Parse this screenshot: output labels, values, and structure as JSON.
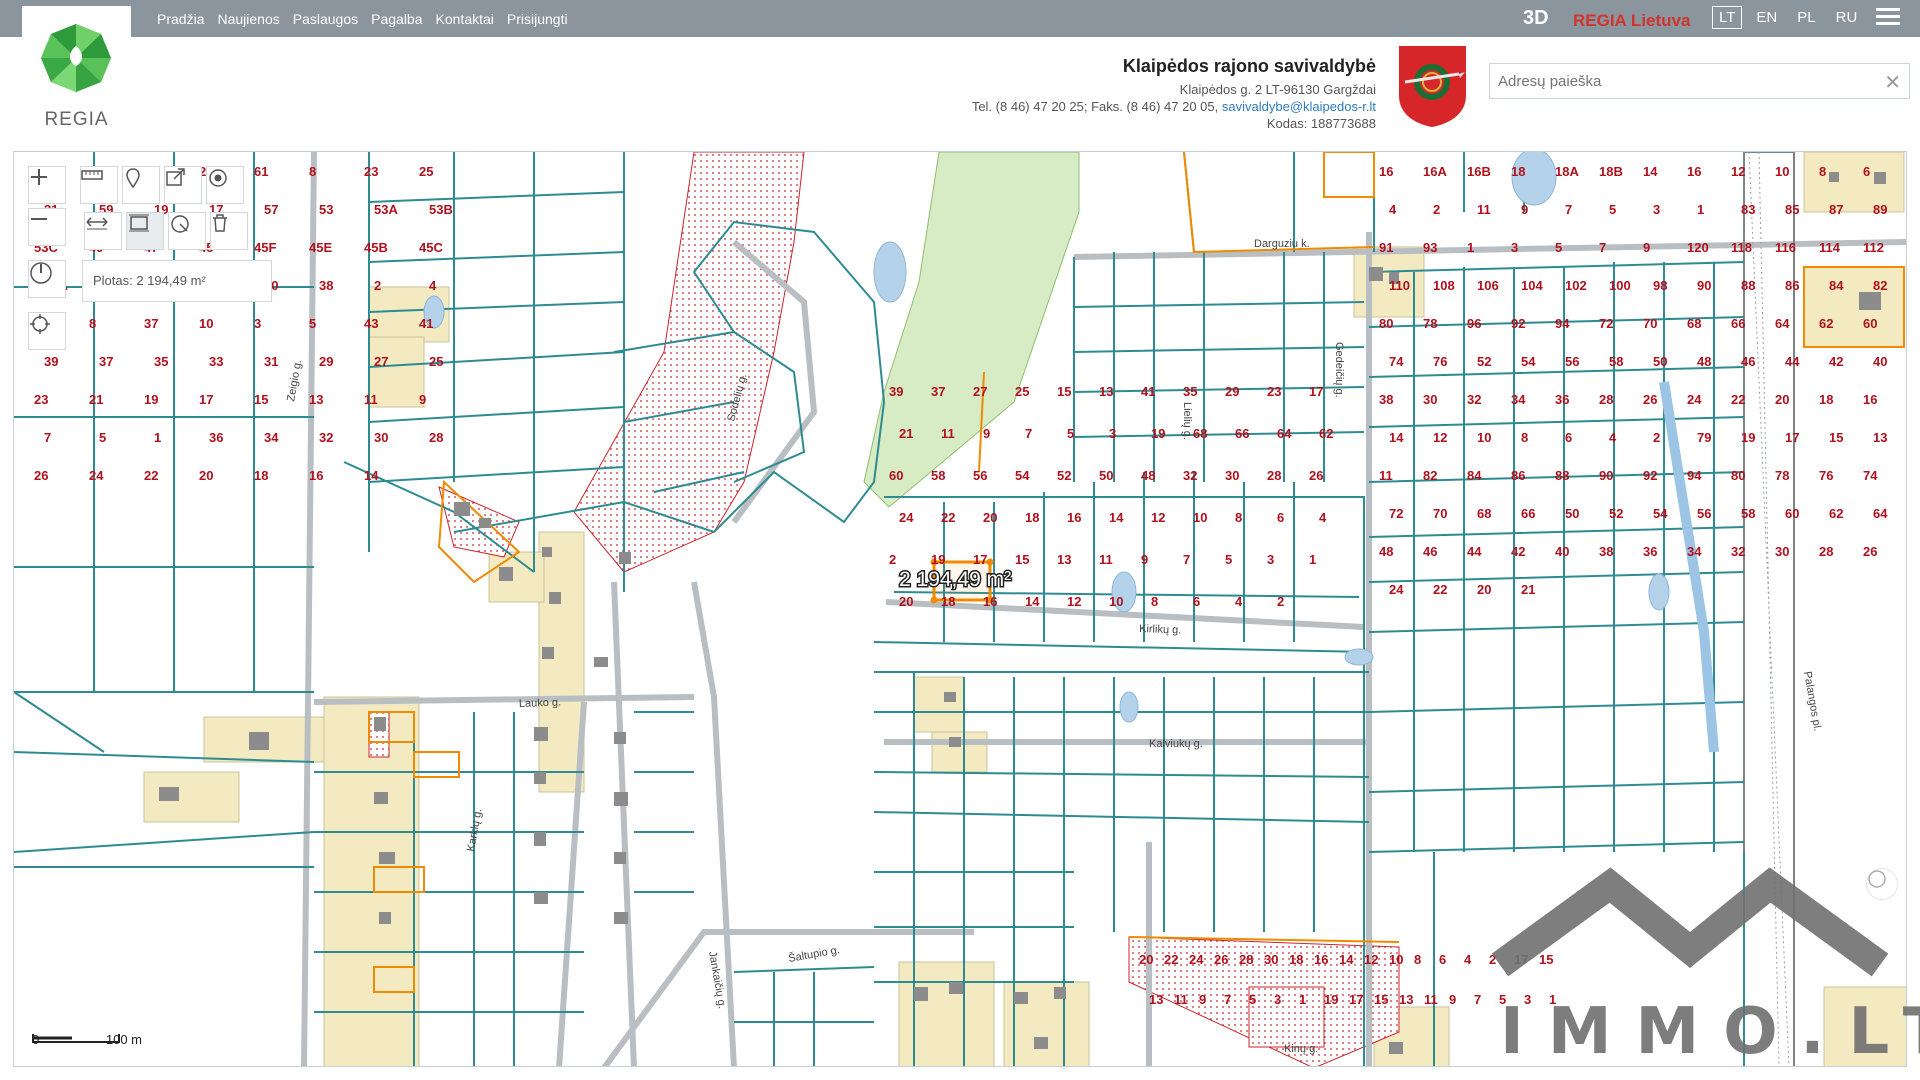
{
  "nav": [
    "Pradžia",
    "Naujienos",
    "Paslaugos",
    "Pagalba",
    "Kontaktai",
    "Prisijungti"
  ],
  "brand_3d": "3D",
  "brand_regia": "REGIA Lietuva",
  "languages": [
    {
      "code": "LT",
      "active": true
    },
    {
      "code": "EN"
    },
    {
      "code": "PL"
    },
    {
      "code": "RU"
    }
  ],
  "logo_text": "REGIA",
  "municipality": {
    "name": "Klaipėdos rajono savivaldybė",
    "address": "Klaipėdos g. 2 LT-96130 Gargždai",
    "phone": "Tel. (8 46) 47 20 25; Faks. (8 46) 47 20 05,",
    "email": "savivaldybe@klaipedos-r.lt",
    "code": "Kodas: 188773688"
  },
  "search": {
    "placeholder": "Adresų paieška"
  },
  "map": {
    "measure_label": "2 194,49 m²",
    "area_text": "Plotas: 2 194,49 m²",
    "scale": {
      "zero": "0",
      "end": "100 m"
    },
    "streets": [
      "Darguziu k.",
      "Zeigio g.",
      "Sodelių g.",
      "Karklų g.",
      "Lauko g.",
      "Jankaičių g.",
      "Kirlikų g.",
      "Kalviukų g.",
      "Šaltupio g.",
      "Gedeičių g.",
      "Palangos pl.",
      "Lielių g.",
      "Kinų g."
    ],
    "parcel_numbers_left": [
      "31",
      "29",
      "10",
      "27",
      "61",
      "8",
      "23",
      "25",
      "21",
      "59",
      "19",
      "17",
      "57",
      "53",
      "53A",
      "53B",
      "53C",
      "49",
      "47",
      "45",
      "45F",
      "45E",
      "45B",
      "45C",
      "45A",
      "46",
      "44",
      "42",
      "40",
      "38",
      "2",
      "4",
      "6",
      "8",
      "37",
      "10",
      "3",
      "5",
      "43",
      "41",
      "39",
      "37",
      "35",
      "33",
      "31",
      "29",
      "27",
      "25",
      "23",
      "21",
      "19",
      "17",
      "15",
      "13",
      "11",
      "9",
      "7",
      "5",
      "1",
      "36",
      "34",
      "32",
      "30",
      "28",
      "26",
      "24",
      "22",
      "20",
      "18",
      "16",
      "14"
    ],
    "parcel_numbers_mid": [
      "39",
      "37",
      "27",
      "25",
      "15",
      "13",
      "41",
      "35",
      "29",
      "23",
      "17",
      "21",
      "11",
      "9",
      "7",
      "5",
      "3",
      "19",
      "68",
      "66",
      "64",
      "62",
      "60",
      "58",
      "56",
      "54",
      "52",
      "50",
      "48",
      "32",
      "30",
      "28",
      "26",
      "24",
      "22",
      "20",
      "18",
      "16",
      "14",
      "12",
      "10",
      "8",
      "6",
      "4",
      "2",
      "19",
      "17",
      "15",
      "13",
      "11",
      "9",
      "7",
      "5",
      "3",
      "1",
      "20",
      "18",
      "16",
      "14",
      "12",
      "10",
      "8",
      "6",
      "4",
      "2"
    ],
    "parcel_numbers_right": [
      "16",
      "16A",
      "16B",
      "18",
      "18A",
      "18B",
      "14",
      "16",
      "12",
      "10",
      "8",
      "6",
      "4",
      "2",
      "11",
      "9",
      "7",
      "5",
      "3",
      "1",
      "83",
      "85",
      "87",
      "89",
      "91",
      "93",
      "1",
      "3",
      "5",
      "7",
      "9",
      "120",
      "118",
      "116",
      "114",
      "112",
      "110",
      "108",
      "106",
      "104",
      "102",
      "100",
      "98",
      "90",
      "88",
      "86",
      "84",
      "82",
      "80",
      "78",
      "96",
      "92",
      "94",
      "72",
      "70",
      "68",
      "66",
      "64",
      "62",
      "60",
      "74",
      "76",
      "52",
      "54",
      "56",
      "58",
      "50",
      "48",
      "46",
      "44",
      "42",
      "40",
      "38",
      "30",
      "32",
      "34",
      "36",
      "28",
      "26",
      "24",
      "22",
      "20",
      "18",
      "16",
      "14",
      "12",
      "10",
      "8",
      "6",
      "4",
      "2",
      "79",
      "19",
      "17",
      "15",
      "13",
      "11",
      "82",
      "84",
      "86",
      "88",
      "90",
      "92",
      "94",
      "80",
      "78",
      "76",
      "74",
      "72",
      "70",
      "68",
      "66",
      "50",
      "52",
      "54",
      "56",
      "58",
      "60",
      "62",
      "64",
      "48",
      "46",
      "44",
      "42",
      "40",
      "38",
      "36",
      "34",
      "32",
      "30",
      "28",
      "26",
      "24",
      "22",
      "20",
      "21"
    ],
    "parcel_numbers_bottom": [
      "20",
      "22",
      "24",
      "26",
      "28",
      "30",
      "18",
      "16",
      "14",
      "12",
      "10",
      "8",
      "6",
      "4",
      "2",
      "17",
      "15",
      "13",
      "11",
      "9",
      "7",
      "5",
      "3",
      "1",
      "19",
      "17",
      "15",
      "13",
      "11",
      "9",
      "7",
      "5",
      "3",
      "1"
    ]
  },
  "watermark": "IMMO.LT",
  "colors": {
    "topbar": "#8b959d",
    "parcel": "#2e8b92",
    "label": "#b0121e",
    "measure": "#f08a00",
    "forest": "#d7ebc4",
    "building_zone": "#f3eac1"
  }
}
